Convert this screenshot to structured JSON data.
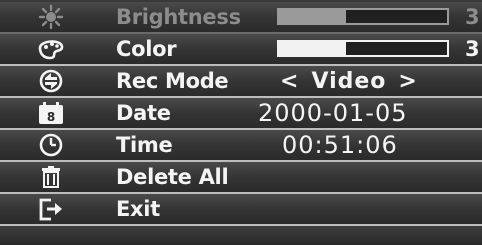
{
  "menu": {
    "items": [
      {
        "label": "Brightness",
        "icon": "sun-icon",
        "value": "3",
        "level": 0.4,
        "state": "disabled"
      },
      {
        "label": "Color",
        "icon": "palette-icon",
        "value": "3",
        "level": 0.4,
        "state": "normal"
      },
      {
        "label": "Rec Mode",
        "icon": "rec-mode-icon",
        "value": "Video",
        "prev": "<",
        "next": ">"
      },
      {
        "label": "Date",
        "icon": "calendar-icon",
        "calendar_day": "8",
        "value": "2000-01-05"
      },
      {
        "label": "Time",
        "icon": "clock-icon",
        "value": "00:51:06"
      },
      {
        "label": "Delete All",
        "icon": "trash-icon"
      },
      {
        "label": "Exit",
        "icon": "exit-icon"
      }
    ]
  },
  "colors": {
    "background": "#2d2d2d",
    "text": "#f4f4f4",
    "disabled_text": "#8c8c8c",
    "row_divider": "#bdbdbd"
  }
}
